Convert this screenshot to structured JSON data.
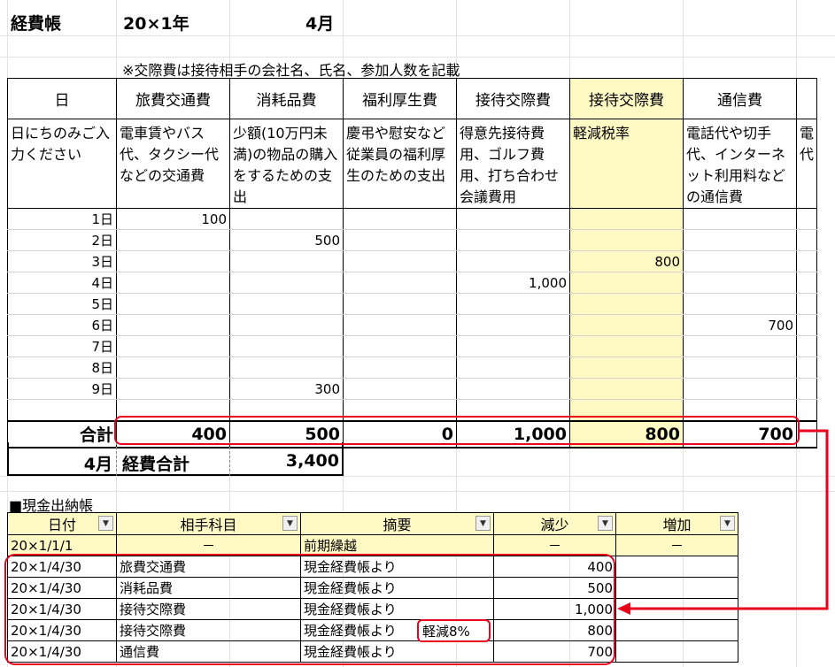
{
  "header": {
    "title": "経費帳",
    "year": "20×1年",
    "month": "4月",
    "note": "※交際費は接待相手の会社名、氏名、参加人数を記載"
  },
  "expense_table": {
    "columns": [
      {
        "label": "日",
        "desc": "日にちのみご入力ください",
        "highlight": false
      },
      {
        "label": "旅費交通費",
        "desc": "電車賃やバス代、タクシー代などの交通費",
        "highlight": false
      },
      {
        "label": "消耗品費",
        "desc": "少額(10万円未満)の物品の購入をするための支出",
        "highlight": false
      },
      {
        "label": "福利厚生費",
        "desc": "慶弔や慰安など従業員の福利厚生のための支出",
        "highlight": false
      },
      {
        "label": "接待交際費",
        "desc": "得意先接待費用、ゴルフ費用、打ち合わせ会議費用",
        "highlight": false
      },
      {
        "label": "接待交際費",
        "desc": "軽減税率",
        "highlight": true
      },
      {
        "label": "通信費",
        "desc": "電話代や切手代、インターネット利用料などの通信費",
        "highlight": false
      },
      {
        "label": "",
        "desc": "電代",
        "highlight": false
      }
    ],
    "rows": [
      [
        "1日",
        "100",
        "",
        "",
        "",
        "",
        "",
        ""
      ],
      [
        "2日",
        "",
        "500",
        "",
        "",
        "",
        "",
        ""
      ],
      [
        "3日",
        "",
        "",
        "",
        "",
        "800",
        "",
        ""
      ],
      [
        "4日",
        "",
        "",
        "",
        "1,000",
        "",
        "",
        ""
      ],
      [
        "5日",
        "",
        "",
        "",
        "",
        "",
        "",
        ""
      ],
      [
        "6日",
        "",
        "",
        "",
        "",
        "",
        "700",
        ""
      ],
      [
        "7日",
        "",
        "",
        "",
        "",
        "",
        "",
        ""
      ],
      [
        "8日",
        "",
        "",
        "",
        "",
        "",
        "",
        ""
      ],
      [
        "9日",
        "",
        "300",
        "",
        "",
        "",
        "",
        ""
      ],
      [
        "",
        "",
        "",
        "",
        "",
        "",
        "",
        ""
      ]
    ],
    "total": [
      "合計",
      "400",
      "500",
      "0",
      "1,000",
      "800",
      "700",
      ""
    ]
  },
  "summary": {
    "month": "4月",
    "label": "経費合計",
    "value": "3,400"
  },
  "cash_book": {
    "title": "■現金出納帳",
    "headers": [
      "日付",
      "相手科目",
      "摘要",
      "減少",
      "増加"
    ],
    "dropdown_icon": "▼",
    "rows": [
      [
        "20×1/1/1",
        "－",
        "前期繰越",
        "－",
        "－"
      ],
      [
        "20×1/4/30",
        "旅費交通費",
        "現金経費帳より",
        "400",
        ""
      ],
      [
        "20×1/4/30",
        "消耗品費",
        "現金経費帳より",
        "500",
        ""
      ],
      [
        "20×1/4/30",
        "接待交際費",
        "現金経費帳より",
        "1,000",
        ""
      ],
      [
        "20×1/4/30",
        "接待交際費",
        "現金経費帳より",
        "800",
        ""
      ],
      [
        "20×1/4/30",
        "通信費",
        "現金経費帳より",
        "700",
        ""
      ]
    ],
    "callout": "軽減8%"
  },
  "colors": {
    "highlight": "#fff9c4",
    "annotation": "#e8001c",
    "grid": "#e3e3e3"
  }
}
